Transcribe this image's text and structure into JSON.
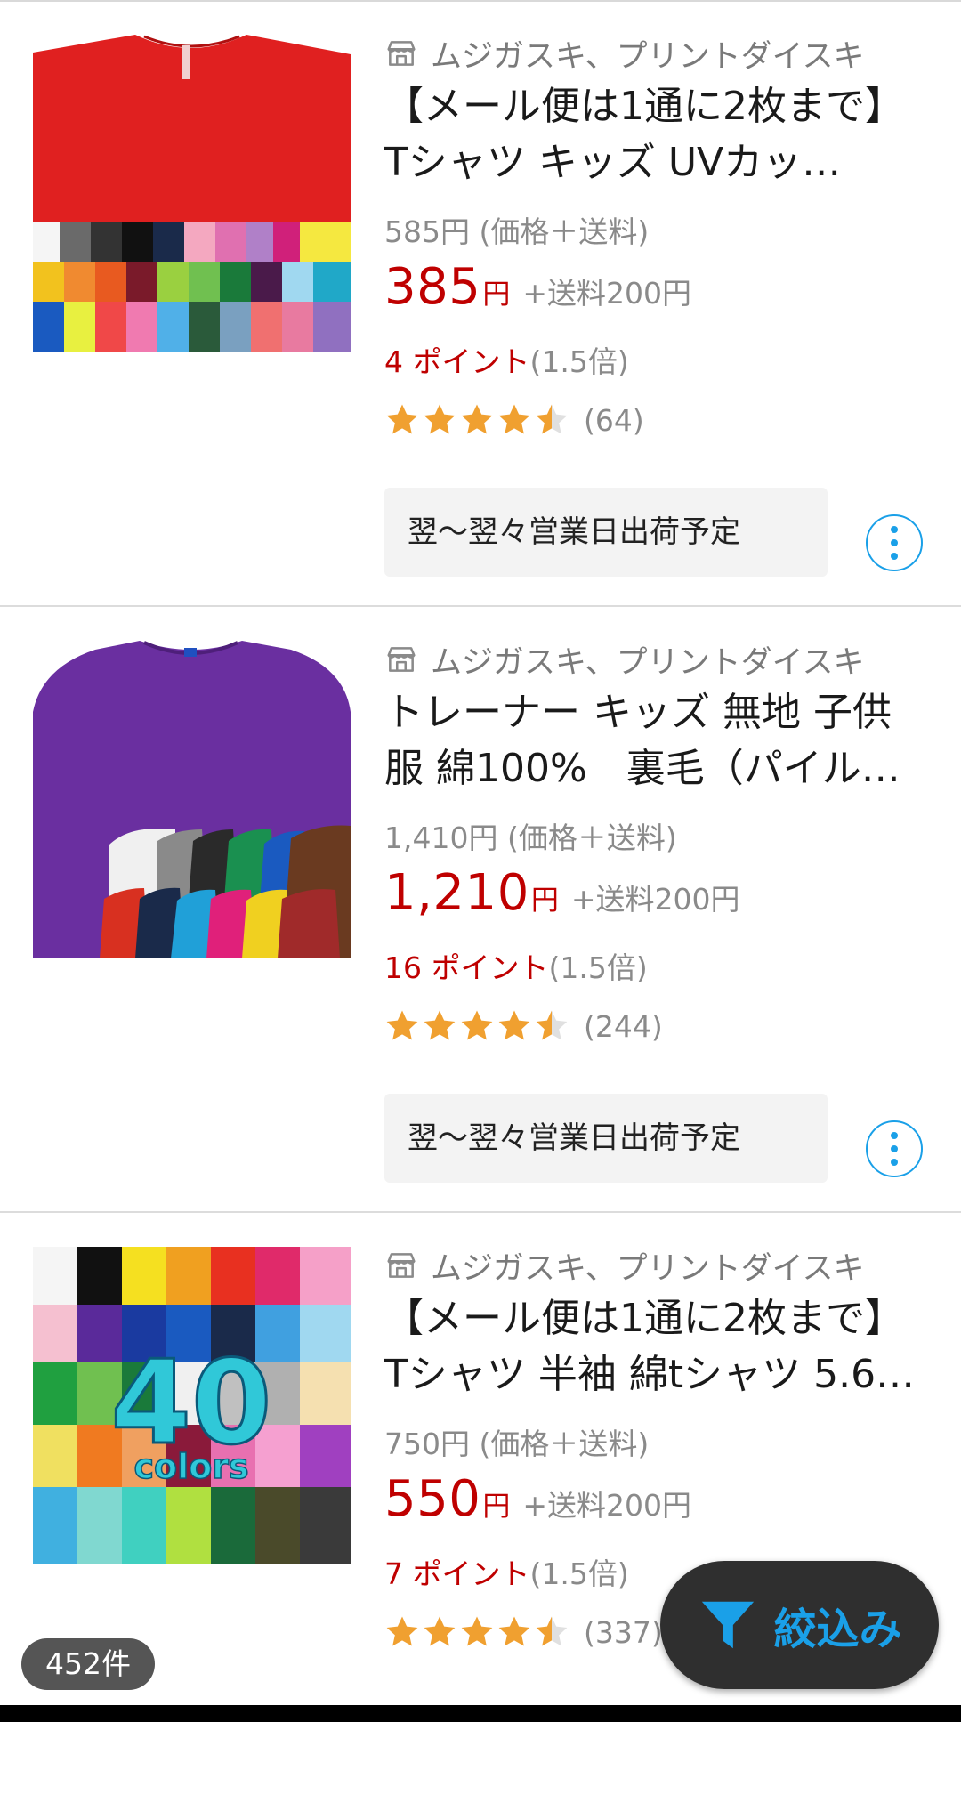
{
  "items": [
    {
      "shop": "ムジガスキ、プリントダイスキ",
      "title": "【メール便は1通に2枚まで】Tシャツ キッズ UVカッ…",
      "original_price": "585円 (価格＋送料)",
      "price": "385",
      "yen": "円",
      "shipping": "+送料200円",
      "points": "4 ポイント",
      "points_mult": "(1.5倍)",
      "rating": 4.5,
      "review_count": "(64)",
      "shipping_note": "翌〜翌々営業日出荷予定",
      "image_kind": "tshirt-red"
    },
    {
      "shop": "ムジガスキ、プリントダイスキ",
      "title": "トレーナー キッズ 無地 子供服 綿100%　裏毛（パイル…",
      "original_price": "1,410円 (価格＋送料)",
      "price": "1,210",
      "yen": "円",
      "shipping": "+送料200円",
      "points": "16 ポイント",
      "points_mult": "(1.5倍)",
      "rating": 4.5,
      "review_count": "(244)",
      "shipping_note": "翌〜翌々営業日出荷予定",
      "image_kind": "sweatshirt-purple"
    },
    {
      "shop": "ムジガスキ、プリントダイスキ",
      "title": "【メール便は1通に2枚まで】Tシャツ 半袖 綿tシャツ 5.6…",
      "original_price": "750円 (価格＋送料)",
      "price": "550",
      "yen": "円",
      "shipping": "+送料200円",
      "points": "7 ポイント",
      "points_mult": "(1.5倍)",
      "rating": 4.5,
      "review_count": "(337)",
      "shipping_note": "翌〜翌々営業日出荷予定",
      "image_kind": "tshirt-40colors",
      "image_text": {
        "number": "40",
        "word": "colors"
      }
    }
  ],
  "result_count": "452件",
  "filter_label": "絞込み",
  "colors": {
    "price_red": "#bf0000",
    "accent_blue": "#1aa0e8",
    "star_orange": "#f0a030",
    "star_empty": "#e0e0e0"
  }
}
